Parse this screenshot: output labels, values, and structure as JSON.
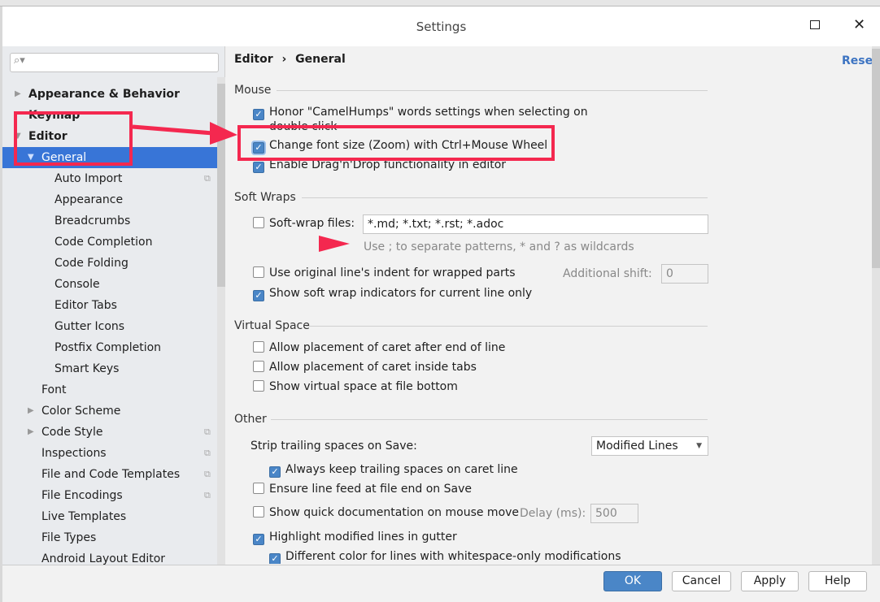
{
  "window": {
    "title": "Settings",
    "maximize_icon": "square-icon",
    "close_icon": "x-icon"
  },
  "sidebar": {
    "search_placeholder": "",
    "items": [
      {
        "label": "Appearance & Behavior",
        "level": 0,
        "bold": true,
        "arrow": "right"
      },
      {
        "label": "Keymap",
        "level": 0,
        "bold": true
      },
      {
        "label": "Editor",
        "level": 0,
        "bold": true,
        "arrow": "down"
      },
      {
        "label": "General",
        "level": 1,
        "arrow": "down",
        "selected": true
      },
      {
        "label": "Auto Import",
        "level": 2,
        "copy": true
      },
      {
        "label": "Appearance",
        "level": 2
      },
      {
        "label": "Breadcrumbs",
        "level": 2
      },
      {
        "label": "Code Completion",
        "level": 2
      },
      {
        "label": "Code Folding",
        "level": 2
      },
      {
        "label": "Console",
        "level": 2
      },
      {
        "label": "Editor Tabs",
        "level": 2
      },
      {
        "label": "Gutter Icons",
        "level": 2
      },
      {
        "label": "Postfix Completion",
        "level": 2
      },
      {
        "label": "Smart Keys",
        "level": 2
      },
      {
        "label": "Font",
        "level": 1
      },
      {
        "label": "Color Scheme",
        "level": 1,
        "arrow": "right"
      },
      {
        "label": "Code Style",
        "level": 1,
        "arrow": "right",
        "copy": true
      },
      {
        "label": "Inspections",
        "level": 1,
        "copy": true
      },
      {
        "label": "File and Code Templates",
        "level": 1,
        "copy": true
      },
      {
        "label": "File Encodings",
        "level": 1,
        "copy": true
      },
      {
        "label": "Live Templates",
        "level": 1
      },
      {
        "label": "File Types",
        "level": 1
      },
      {
        "label": "Android Layout Editor",
        "level": 1
      }
    ]
  },
  "breadcrumb": {
    "parent": "Editor",
    "sep": "›",
    "current": "General"
  },
  "reset_label": "Reset",
  "sections": {
    "mouse": "Mouse",
    "soft_wraps": "Soft Wraps",
    "virtual_space": "Virtual Space",
    "other": "Other"
  },
  "mouse": {
    "camelhumps": {
      "label": "Honor \"CamelHumps\" words settings when selecting on",
      "label2": "double click",
      "checked": true
    },
    "zoom": {
      "label": "Change font size (Zoom) with Ctrl+Mouse Wheel",
      "checked": true
    },
    "dnd": {
      "label": "Enable Drag'n'Drop functionality in editor",
      "checked": true
    }
  },
  "soft_wraps": {
    "files": {
      "label": "Soft-wrap files:",
      "checked": false,
      "value": "*.md; *.txt; *.rst; *.adoc"
    },
    "hint": "Use ; to separate patterns, * and ? as wildcards",
    "indent": {
      "label": "Use original line's indent for wrapped parts",
      "checked": false
    },
    "shift_label": "Additional shift:",
    "shift_value": "0",
    "indicators": {
      "label": "Show soft wrap indicators for current line only",
      "checked": true
    }
  },
  "virtual_space": [
    {
      "label": "Allow placement of caret after end of line",
      "checked": false
    },
    {
      "label": "Allow placement of caret inside tabs",
      "checked": false
    },
    {
      "label": "Show virtual space at file bottom",
      "checked": false
    }
  ],
  "other": {
    "strip_label": "Strip trailing spaces on Save:",
    "strip_value": "Modified Lines",
    "keep_caret": {
      "label": "Always keep trailing spaces on caret line",
      "checked": true
    },
    "line_feed": {
      "label": "Ensure line feed at file end on Save",
      "checked": false
    },
    "quick_doc": {
      "label": "Show quick documentation on mouse move",
      "checked": false
    },
    "delay_label": "Delay (ms):",
    "delay_value": "500",
    "highlight": {
      "label": "Highlight modified lines in gutter",
      "checked": true
    },
    "whitespace": {
      "label": "Different color for lines with whitespace-only modifications",
      "checked": true
    }
  },
  "buttons": {
    "ok": "OK",
    "cancel": "Cancel",
    "apply": "Apply",
    "help": "Help"
  },
  "colors": {
    "accent": "#3875d7",
    "annotation": "#f4284f"
  }
}
